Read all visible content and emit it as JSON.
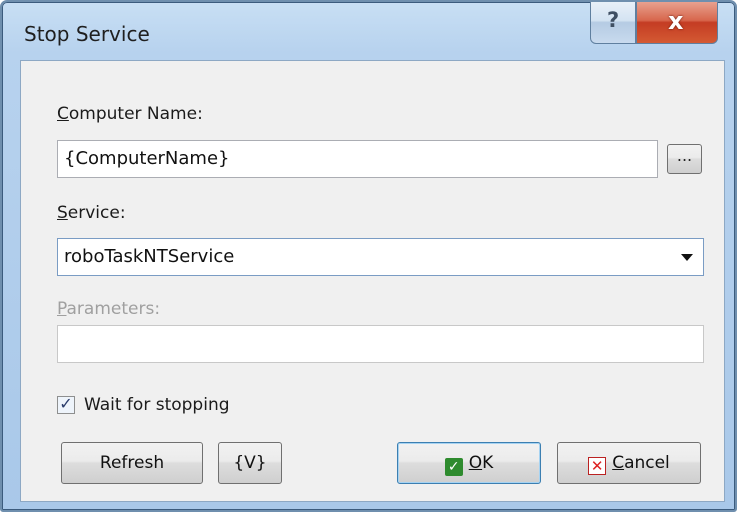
{
  "window": {
    "title": "Stop Service"
  },
  "titlebar": {
    "help_glyph": "?",
    "close_glyph": "x"
  },
  "computer_name": {
    "label_accel": "C",
    "label_rest": "omputer Name:",
    "value": "{ComputerName}",
    "browse_label": "..."
  },
  "service": {
    "label_accel": "S",
    "label_rest": "ervice:",
    "value": "roboTaskNTService"
  },
  "parameters": {
    "label_accel": "P",
    "label_rest": "arameters:",
    "value": "",
    "disabled": true
  },
  "wait_checkbox": {
    "checked": true,
    "mark": "✓",
    "label": "Wait for stopping"
  },
  "buttons": {
    "refresh": "Refresh",
    "var": "{V}",
    "ok_accel": "O",
    "ok_rest": "K",
    "ok_icon": "✓",
    "cancel_accel": "C",
    "cancel_rest": "ancel",
    "cancel_icon": "✕"
  },
  "icons": [
    "help-icon",
    "close-icon",
    "ellipsis-icon",
    "chevron-down-icon",
    "checkmark-icon",
    "cancel-x-icon"
  ]
}
